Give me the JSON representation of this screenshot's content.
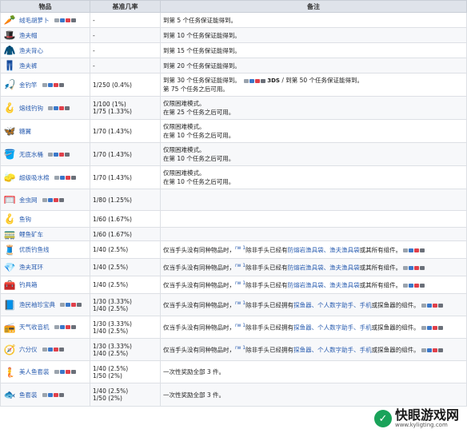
{
  "headers": {
    "item": "物品",
    "rate": "基准几率",
    "note": "备注"
  },
  "rows": [
    {
      "name": "绒毛胡萝卜",
      "icon": "🥕",
      "rate": "-",
      "note": "到第 5 个任务保证能得到。",
      "h": 19
    },
    {
      "name": "渔夫帽",
      "icon": "🎩",
      "rate": "-",
      "note": "到第 10 个任务保证能得到。",
      "h": 19
    },
    {
      "name": "渔夫背心",
      "icon": "🧥",
      "rate": "-",
      "note": "到第 15 个任务保证能得到。",
      "h": 19
    },
    {
      "name": "渔夫裤",
      "icon": "👖",
      "rate": "-",
      "note": "到第 20 个任务保证能得到。",
      "h": 19
    },
    {
      "name": "金钓竿",
      "icon": "🎣",
      "rate": "1/250 (0.4%)",
      "note": "到第 30 个任务保证能得到。",
      "note2": "第 75 个任务之后可用。",
      "h": 29
    },
    {
      "name": "熔线钓钩",
      "icon": "🪝",
      "rate": "1/100 (1%)",
      "rate2": "1/75 (1.33%)",
      "note": "仅限困难模式。",
      "note2": "在第 25 个任务之后可用。",
      "h": 29
    },
    {
      "name": "糖翼",
      "icon": "🦋",
      "rate": "1/70 (1.43%)",
      "note": "仅限困难模式。",
      "note2": "在第 10 个任务之后可用。",
      "h": 29
    },
    {
      "name": "无底水桶",
      "icon": "🪣",
      "rate": "1/70 (1.43%)",
      "note": "仅限困难模式。",
      "note2": "在第 10 个任务之后可用。",
      "h": 29
    },
    {
      "name": "超级吸水棉",
      "icon": "🧽",
      "rate": "1/70 (1.43%)",
      "note": "仅限困难模式。",
      "note2": "在第 10 个任务之后可用。",
      "h": 29
    },
    {
      "name": "金虫网",
      "icon": "🥅",
      "rate": "1/80 (1.25%)",
      "note": "",
      "h": 27
    },
    {
      "name": "鱼钩",
      "icon": "🪝",
      "rate": "1/60 (1.67%)",
      "note": "",
      "h": 21
    },
    {
      "name": "鲤鱼矿车",
      "icon": "🚃",
      "rate": "1/60 (1.67%)",
      "note": "",
      "h": 17
    },
    {
      "name": "优质钓鱼线",
      "icon": "🧵",
      "rate": "1/40 (2.5%)",
      "note": "仅当手头没有同种物品时，",
      "noteA": "除非手头已经有",
      "noteL": "防熔岩渔具袋、渔夫渔具袋",
      "noteB": "或其所有组件。",
      "h": 22
    },
    {
      "name": "渔夫耳环",
      "icon": "💎",
      "rate": "1/40 (2.5%)",
      "note": "仅当手头没有同种物品时，",
      "noteA": "除非手头已经有",
      "noteL": "防熔岩渔具袋、渔夫渔具袋",
      "noteB": "或其所有组件。",
      "h": 22
    },
    {
      "name": "钓具箱",
      "icon": "🧰",
      "rate": "1/40 (2.5%)",
      "note": "仅当手头没有同种物品时，",
      "noteA": "除非手头已经有",
      "noteL": "防熔岩渔具袋、渔夫渔具袋",
      "noteB": "或其所有组件。",
      "h": 22
    },
    {
      "name": "渔民袖珍宝典",
      "icon": "📘",
      "rate": "1/30 (3.33%)",
      "rate2": "1/40 (2.5%)",
      "note": "仅当手头没有同种物品时，",
      "noteA": "除非手头已经拥有",
      "noteL": "探鱼器、个人数字助手、手机",
      "noteB": "或探鱼器的组件。",
      "h": 28
    },
    {
      "name": "天气收音机",
      "icon": "📻",
      "rate": "1/30 (3.33%)",
      "rate2": "1/40 (2.5%)",
      "note": "仅当手头没有同种物品时，",
      "noteA": "除非手头已经拥有",
      "noteL": "探鱼器、个人数字助手、手机",
      "noteB": "或探鱼器的组件。",
      "h": 28
    },
    {
      "name": "六分仪",
      "icon": "🧭",
      "rate": "1/30 (3.33%)",
      "rate2": "1/40 (2.5%)",
      "note": "仅当手头没有同种物品时，",
      "noteA": "除非手头已经拥有",
      "noteL": "探鱼器、个人数字助手、手机",
      "noteB": "或探鱼器的组件。",
      "h": 28
    },
    {
      "name": "美人鱼套装",
      "icon": "🧜",
      "rate": "1/40 (2.5%)",
      "rate2": "1/50 (2%)",
      "note": "一次性奖励全部 3 件。",
      "h": 28
    },
    {
      "name": "鱼套装",
      "icon": "🐟",
      "rate": "1/40 (2.5%)",
      "rate2": "1/50 (2%)",
      "note": "一次性奖励全部 3 件。",
      "h": 29
    }
  ],
  "fragments": {
    "or": "/ 到第 50 个任务保证能得到。",
    "ds": "3DS",
    "rw": "rw 1"
  },
  "watermark": {
    "title": "快眼游戏网",
    "url": "www.kyligting.com"
  }
}
